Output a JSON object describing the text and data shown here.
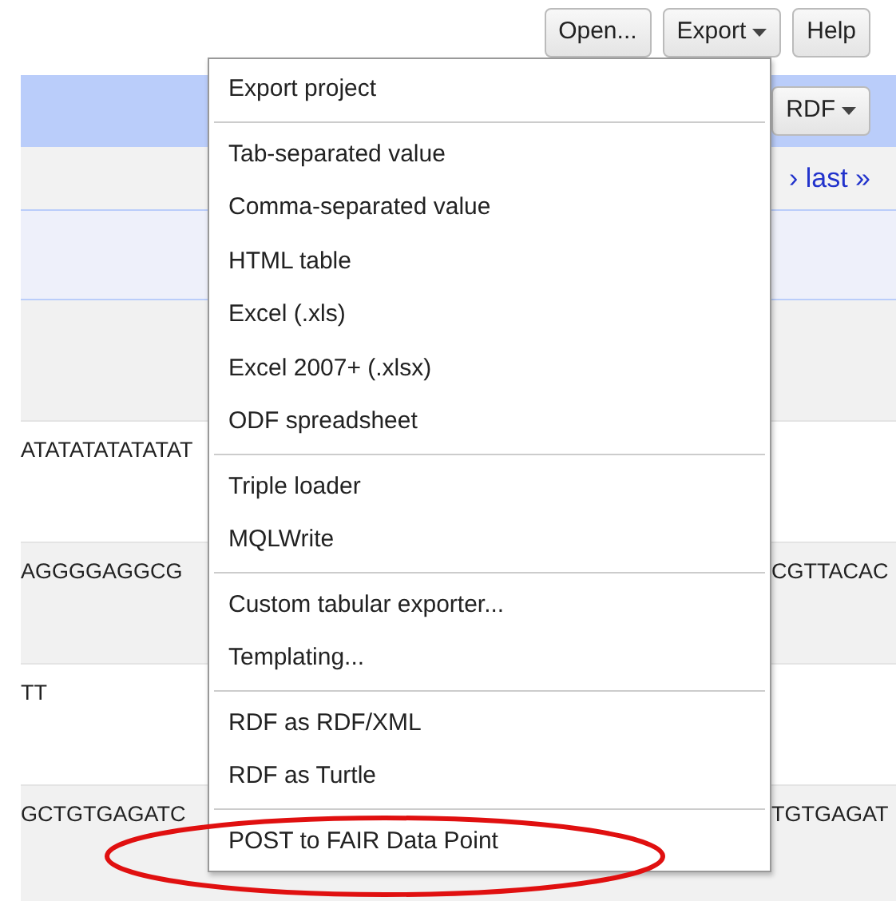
{
  "toolbar": {
    "buttons": [
      {
        "label": "Open...",
        "has_caret": false
      },
      {
        "label": "Export",
        "has_caret": true
      },
      {
        "label": "Help",
        "has_caret": false
      }
    ]
  },
  "header": {
    "button": "RDF"
  },
  "pager": {
    "link": "› last »"
  },
  "rows": [
    {
      "left": "",
      "right": ""
    },
    {
      "left": "ATATATATATATAT",
      "right": ""
    },
    {
      "left": "AGGGGAGGCG",
      "right": "CGTTACAC"
    },
    {
      "left": "TT",
      "right": ""
    },
    {
      "left": "GCTGTGAGATC",
      "right": "TGTGAGAT"
    }
  ],
  "menu": {
    "sections": [
      [
        "Export project"
      ],
      [
        "Tab-separated value",
        "Comma-separated value",
        "HTML table",
        "Excel (.xls)",
        "Excel 2007+ (.xlsx)",
        "ODF spreadsheet"
      ],
      [
        "Triple loader",
        "MQLWrite"
      ],
      [
        "Custom tabular exporter...",
        "Templating..."
      ],
      [
        "RDF as RDF/XML",
        "RDF as Turtle"
      ],
      [
        "POST to FAIR Data Point"
      ]
    ]
  },
  "annotation": {
    "kind": "ellipse"
  }
}
